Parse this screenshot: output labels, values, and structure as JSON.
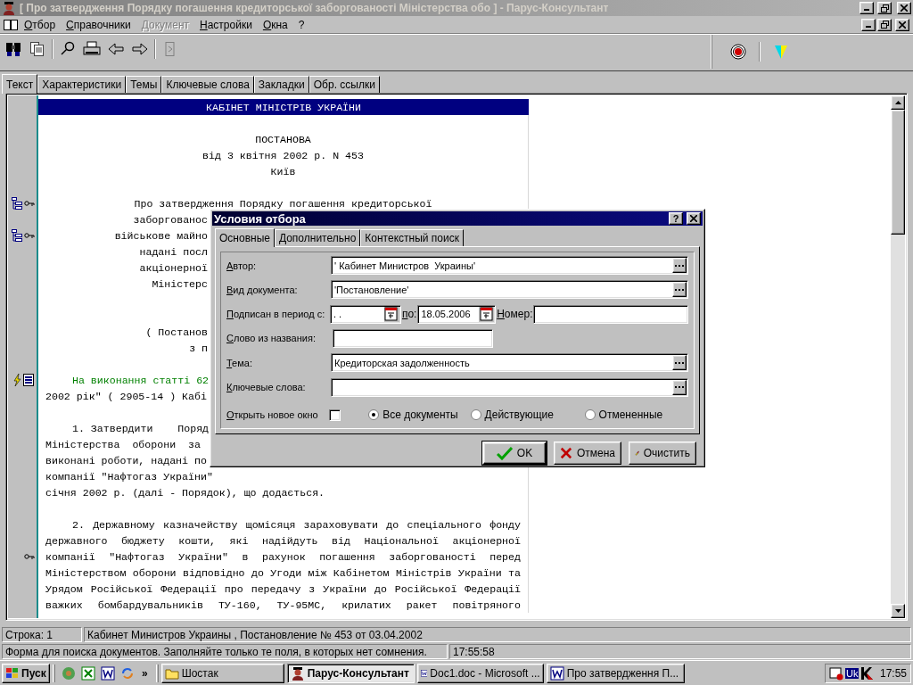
{
  "window": {
    "title": "[ Про затвердження Порядку погашення кредиторської заборгованості Міністерства обо ] - Парус-Консультант",
    "active": false
  },
  "menu": [
    {
      "label": "Отбор",
      "disabled": false
    },
    {
      "label": "Справочники",
      "disabled": false
    },
    {
      "label": "Документ",
      "disabled": true
    },
    {
      "label": "Настройки",
      "disabled": false
    },
    {
      "label": "Окна",
      "disabled": false
    },
    {
      "label": "?",
      "disabled": false
    }
  ],
  "toolbar": [
    {
      "kind": "find",
      "disabled": false
    },
    {
      "kind": "pages",
      "disabled": false
    },
    {
      "kind": "separator"
    },
    {
      "kind": "zoom",
      "disabled": false
    },
    {
      "kind": "print",
      "disabled": false
    },
    {
      "kind": "back",
      "disabled": false
    },
    {
      "kind": "forward",
      "disabled": false
    },
    {
      "kind": "separator"
    },
    {
      "kind": "exit",
      "disabled": true
    }
  ],
  "toolbar_right": [
    {
      "kind": "target",
      "disabled": false
    },
    {
      "kind": "separator"
    },
    {
      "kind": "filter",
      "disabled": false
    }
  ],
  "tabs": [
    {
      "label": "Текст",
      "selected": true
    },
    {
      "label": "Характеристики",
      "selected": false
    },
    {
      "label": "Темы",
      "selected": false
    },
    {
      "label": "Ключевые слова",
      "selected": false
    },
    {
      "label": "Закладки",
      "selected": false
    },
    {
      "label": "Обр. ссылки",
      "selected": false
    }
  ],
  "document": {
    "lines": [
      {
        "kind": "heading",
        "text": "КАБІНЕТ МІНІСТРІВ УКРАЇНИ"
      },
      {
        "kind": "blank"
      },
      {
        "kind": "centered",
        "text": "ПОСТАНОВА"
      },
      {
        "kind": "centered",
        "text": "від 3 квітня 2002 р. N 453"
      },
      {
        "kind": "centered",
        "text": "Київ"
      },
      {
        "kind": "blank"
      },
      {
        "kind": "centered",
        "text": "Про затвердження Порядку погашення кредиторської"
      },
      {
        "kind": "cut",
        "text": "заборгованос"
      },
      {
        "kind": "cut",
        "text": "військове майно"
      },
      {
        "kind": "cut",
        "text": "надані посл"
      },
      {
        "kind": "cut",
        "text": "акціонерної"
      },
      {
        "kind": "cut",
        "text": "Міністерс"
      },
      {
        "kind": "blank"
      },
      {
        "kind": "blank"
      },
      {
        "kind": "cut",
        "text": "( Постанов"
      },
      {
        "kind": "cut",
        "text": "з п"
      },
      {
        "kind": "blank"
      },
      {
        "kind": "link",
        "text": "На виконання статті 62"
      },
      {
        "kind": "line",
        "text": "2002 рік\" ( 2905-14 ) Кабі"
      },
      {
        "kind": "blank"
      },
      {
        "kind": "paragraph",
        "text": "1. Затвердити    Поряд"
      },
      {
        "kind": "line",
        "text": "Міністерства  оборони  за"
      },
      {
        "kind": "line",
        "text": "виконані роботи, надані по"
      },
      {
        "kind": "line",
        "text": "компанії \"Нафтогаз України\""
      },
      {
        "kind": "line",
        "text": "січня 2002 р. (далі - Порядок), що додається."
      },
      {
        "kind": "blank"
      },
      {
        "kind": "justified-paragraph",
        "text": "2. Державному казначейству щомісяця зараховувати до  спеціального  фонду"
      },
      {
        "kind": "justified",
        "text": "державного  бюджету  кошти,  які  надійдуть  від  Національної  акціонерної"
      },
      {
        "kind": "justified",
        "text": "компанії  \"Нафтогаз України\"  в  рахунок  погашення  заборгованості  перед"
      },
      {
        "kind": "justified",
        "text": "Міністерством оборони відповідно до Угоди між Кабінетом Міністрів України та"
      },
      {
        "kind": "justified",
        "text": "Урядом Російської Федерації про передачу з України до  Російської  Федерації"
      },
      {
        "kind": "justified",
        "text": "важких  бомбардувальників  ТУ-160,  ТУ-95МС,  крилатих  ракет   повітряного"
      }
    ]
  },
  "dialog": {
    "title": "Условия отбора",
    "help": "?",
    "tabs": [
      {
        "label": "Основные",
        "selected": true
      },
      {
        "label": "Дополнительно",
        "selected": false
      },
      {
        "label": "Контекстный поиск",
        "selected": false
      }
    ],
    "fields": [
      {
        "kind": "lookup",
        "label": "Автор:",
        "value": "' Кабинет Министров  Украины'"
      },
      {
        "kind": "lookup",
        "label": "Вид документа:",
        "value": "'Постановление'"
      },
      {
        "kind": "period",
        "label": "Подписан в период с:",
        "from": ". .",
        "to_label": "по:",
        "to": "18.05.2006",
        "number_label": "Номер:"
      },
      {
        "kind": "text",
        "label": "Слово из названия:"
      },
      {
        "kind": "lookup",
        "label": "Тема:",
        "value": "Кредиторская задолженность"
      },
      {
        "kind": "lookup",
        "label": "Ключевые слова:"
      }
    ],
    "new_window": {
      "label": "Открыть новое окно",
      "checked": false
    },
    "scope": [
      {
        "label": "Все документы",
        "selected": true
      },
      {
        "label": "Действующие",
        "selected": false
      },
      {
        "label": "Отмененные",
        "selected": false
      }
    ],
    "buttons": [
      {
        "kind": "ok",
        "label": "OK",
        "default": true
      },
      {
        "kind": "cancel",
        "label": "Отмена",
        "default": false
      },
      {
        "kind": "clear",
        "label": "Очистить",
        "default": false
      }
    ]
  },
  "status_bar": {
    "line": "Строка: 1",
    "document": "Кабинет Министров  Украины , Постановление  № 453 от 03.04.2002"
  },
  "hint_bar": {
    "text": "Форма для поиска документов. Заполняйте только те поля, в которых нет сомнения.",
    "time": "17:55:58"
  },
  "taskbar": {
    "start": "Пуск",
    "more": "»",
    "tasks": [
      {
        "kind": "folder",
        "label": "Шостак",
        "selected": false
      },
      {
        "kind": "app",
        "label": "Парус-Консультант",
        "selected": true
      },
      {
        "kind": "word",
        "label": "Doc1.doc - Microsoft ...",
        "selected": false
      },
      {
        "kind": "word",
        "label": "Про затвердження П...",
        "selected": false
      }
    ],
    "language": "Uk",
    "clock": "17:55"
  }
}
